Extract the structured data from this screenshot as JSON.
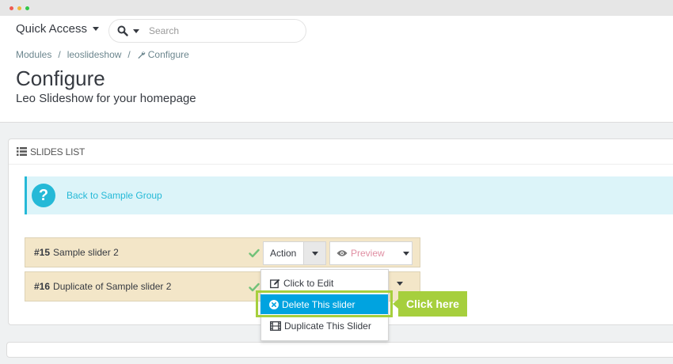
{
  "header": {
    "quick_access_label": "Quick Access",
    "search_placeholder": "Search",
    "breadcrumb": [
      "Modules",
      "leoslideshow",
      "Configure"
    ],
    "title": "Configure",
    "subtitle": "Leo Slideshow for your homepage"
  },
  "panel": {
    "heading": "SLIDES LIST",
    "alert_link": "Back to Sample Group",
    "help_icon_label": "?",
    "rows": [
      {
        "id": "#15",
        "name": "Sample slider 2"
      },
      {
        "id": "#16",
        "name": "Duplicate of Sample slider 2"
      }
    ],
    "action_label": "Action",
    "preview_label": "Preview"
  },
  "dropdown": {
    "items": [
      "Click to Edit",
      "Delete This slider",
      "Duplicate This Slider"
    ]
  },
  "callout": {
    "label": "Click here"
  },
  "colors": {
    "accent": "#25b9d7",
    "row_bg": "#f3e6c8",
    "highlight": "#a6cf3d",
    "preview_text": "#e08fa3"
  }
}
